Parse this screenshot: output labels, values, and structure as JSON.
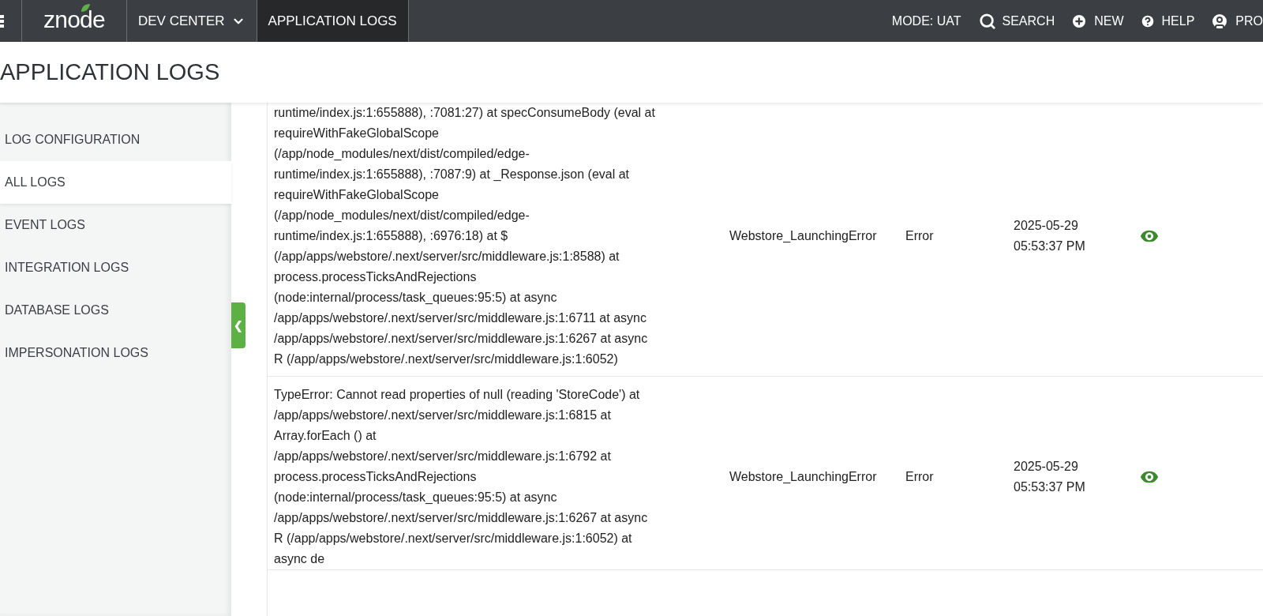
{
  "topbar": {
    "logo": "znode",
    "nav": [
      {
        "label": "DEV CENTER",
        "kind": "dropdown",
        "selected": false
      },
      {
        "label": "APPLICATION LOGS",
        "kind": "link",
        "selected": true
      }
    ],
    "mode": "MODE: UAT",
    "actions": [
      {
        "kind": "search",
        "label": "SEARCH"
      },
      {
        "kind": "new",
        "label": "NEW"
      },
      {
        "kind": "help",
        "label": "HELP"
      },
      {
        "kind": "profile",
        "label": "PRO"
      }
    ]
  },
  "page_title": "APPLICATION LOGS",
  "sidebar": {
    "items": [
      {
        "label": "LOG CONFIGURATION",
        "selected": false
      },
      {
        "label": "ALL LOGS",
        "selected": true
      },
      {
        "label": "EVENT LOGS",
        "selected": false
      },
      {
        "label": "INTEGRATION LOGS",
        "selected": false
      },
      {
        "label": "DATABASE LOGS",
        "selected": false
      },
      {
        "label": "IMPERSONATION LOGS",
        "selected": false
      }
    ],
    "collapse": "❮"
  },
  "table": {
    "rows": [
      {
        "message": [
          "runtime/index.js:1:655888), :7081:27) at specConsumeBody (eval at",
          "requireWithFakeGlobalScope",
          "(/app/node_modules/next/dist/compiled/edge-",
          "runtime/index.js:1:655888), :7087:9) at _Response.json (eval at",
          "requireWithFakeGlobalScope",
          "(/app/node_modules/next/dist/compiled/edge-",
          "runtime/index.js:1:655888), :6976:18) at $",
          "(/app/apps/webstore/.next/server/src/middleware.js:1:8588) at",
          "process.processTicksAndRejections",
          "(node:internal/process/task_queues:95:5) at async",
          "/app/apps/webstore/.next/server/src/middleware.js:1:6711 at async",
          "/app/apps/webstore/.next/server/src/middleware.js:1:6267 at async",
          "R (/app/apps/webstore/.next/server/src/middleware.js:1:6052)"
        ],
        "name": "Webstore_LaunchingError",
        "level": "Error",
        "date": "2025-05-29",
        "time": "05:53:37 PM"
      },
      {
        "message": [
          "TypeError: Cannot read properties of null (reading 'StoreCode') at",
          "/app/apps/webstore/.next/server/src/middleware.js:1:6815 at",
          "Array.forEach () at",
          "/app/apps/webstore/.next/server/src/middleware.js:1:6792 at",
          "process.processTicksAndRejections",
          "(node:internal/process/task_queues:95:5) at async",
          "/app/apps/webstore/.next/server/src/middleware.js:1:6267 at async",
          "R (/app/apps/webstore/.next/server/src/middleware.js:1:6052) at",
          "async de"
        ],
        "name": "Webstore_LaunchingError",
        "level": "Error",
        "date": "2025-05-29",
        "time": "05:53:37 PM"
      }
    ]
  }
}
